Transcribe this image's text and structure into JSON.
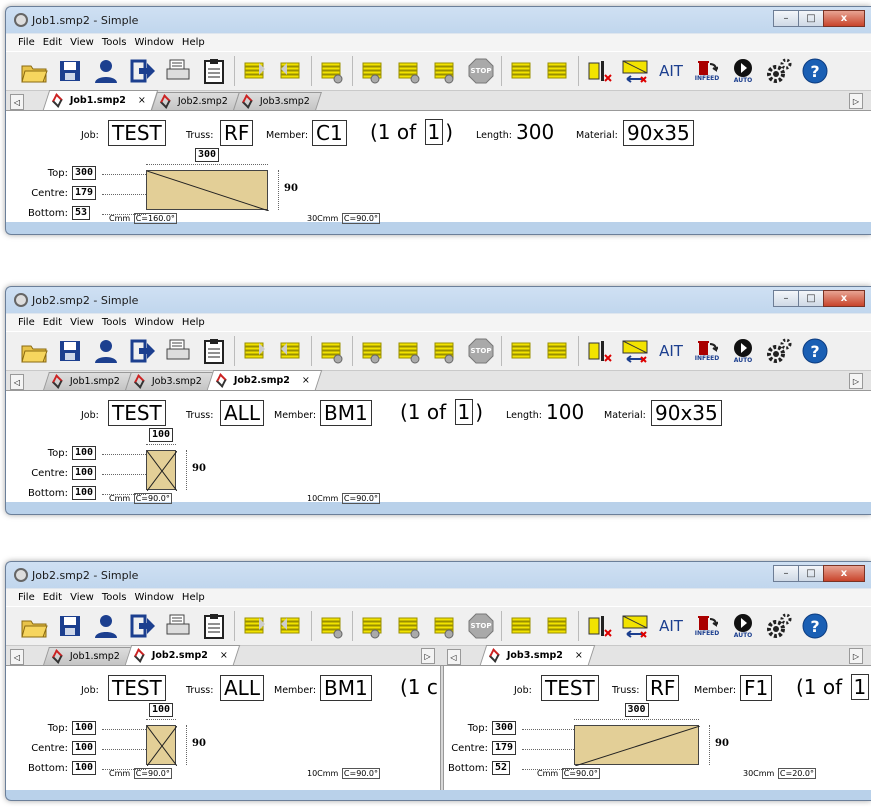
{
  "windows": [
    {
      "title": "Job1.smp2 - Simple",
      "tabs": [
        {
          "label": "Job1.smp2",
          "active": true
        },
        {
          "label": "Job2.smp2",
          "active": false
        },
        {
          "label": "Job3.smp2",
          "active": false
        }
      ],
      "job": "TEST",
      "truss": "RF",
      "member": "C1",
      "of_prefix": "(1 of",
      "of_count": "1",
      "of_suffix": ")",
      "length": "300",
      "material": "90x35",
      "top": "300",
      "centre": "179",
      "bottom": "53",
      "width_label": "300",
      "height_label": "90",
      "cut_left": "C=160.0°",
      "cut_left_prefix": "Cmm",
      "cut_right": "C=90.0°",
      "cut_right_prefix": "30Cmm"
    },
    {
      "title": "Job2.smp2 - Simple",
      "tabs": [
        {
          "label": "Job1.smp2",
          "active": false
        },
        {
          "label": "Job3.smp2",
          "active": false
        },
        {
          "label": "Job2.smp2",
          "active": true
        }
      ],
      "job": "TEST",
      "truss": "ALL",
      "member": "BM1",
      "of_prefix": "(1 of",
      "of_count": "1",
      "of_suffix": ")",
      "length": "100",
      "material": "90x35",
      "top": "100",
      "centre": "100",
      "bottom": "100",
      "width_label": "100",
      "height_label": "90",
      "cut_left": "C=90.0°",
      "cut_left_prefix": "Cmm",
      "cut_right": "C=90.0°",
      "cut_right_prefix": "10Cmm"
    },
    {
      "title": "Job2.smp2 - Simple",
      "left_tabs": [
        {
          "label": "Job1.smp2",
          "active": false
        },
        {
          "label": "Job2.smp2",
          "active": true
        }
      ],
      "right_tabs": [
        {
          "label": "Job3.smp2",
          "active": true
        }
      ],
      "left": {
        "job": "TEST",
        "truss": "ALL",
        "member": "BM1",
        "of_prefix": "(1 c",
        "top": "100",
        "centre": "100",
        "bottom": "100",
        "width_label": "100",
        "height_label": "90",
        "cut_left": "C=90.0°",
        "cut_left_prefix": "Cmm",
        "cut_right": "C=90.0°",
        "cut_right_prefix": "10Cmm"
      },
      "right": {
        "job": "TEST",
        "truss": "RF",
        "member": "F1",
        "of_prefix": "(1 of",
        "of_count": "1",
        "top": "300",
        "centre": "179",
        "bottom": "52",
        "width_label": "300",
        "height_label": "90",
        "cut_left": "C=90.0°",
        "cut_left_prefix": "Cmm",
        "cut_right": "C=20.0°",
        "cut_right_prefix": "30Cmm"
      }
    }
  ],
  "labels": {
    "job": "Job:",
    "truss": "Truss:",
    "member": "Member:",
    "length": "Length:",
    "material": "Material:",
    "top": "Top:",
    "centre": "Centre:",
    "bottom": "Bottom:"
  },
  "menu": [
    "File",
    "Edit",
    "View",
    "Tools",
    "Window",
    "Help"
  ],
  "toolbar": {
    "ait": "AIT",
    "infeed": "INFEED",
    "auto": "AUTO",
    "stop": "STOP"
  },
  "icons": [
    "open-folder-icon",
    "save-icon",
    "user-icon",
    "exit-icon",
    "print-icon",
    "clipboard-icon",
    "stack-icon",
    "stop-icon",
    "settings-icon",
    "help-icon"
  ],
  "colors": {
    "board": "#e3cf97",
    "toolbar_yellow": "#f2e300",
    "help": "#1a5fb4",
    "stop": "#a9a9a9"
  }
}
